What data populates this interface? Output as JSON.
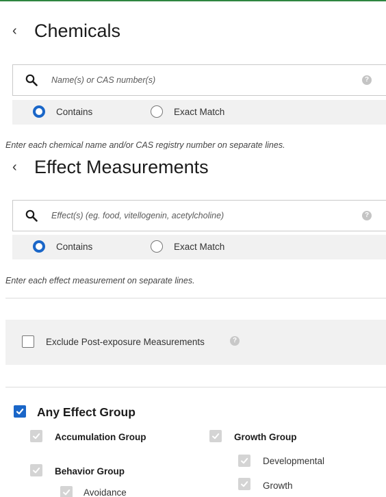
{
  "colors": {
    "accent": "#1a66c8",
    "top_border": "#2e8540",
    "panel": "#f1f1f1"
  },
  "chemicals": {
    "back_icon": "chevron-left-icon",
    "title": "Chemicals",
    "search_placeholder": "Name(s) or CAS number(s)",
    "options": [
      {
        "label": "Contains",
        "selected": true
      },
      {
        "label": "Exact Match",
        "selected": false
      }
    ],
    "hint": "Enter each chemical name and/or CAS registry number on separate lines."
  },
  "effects": {
    "back_icon": "chevron-left-icon",
    "title": "Effect Measurements",
    "search_placeholder": "Effect(s) (eg. food, vitellogenin, acetylcholine)",
    "options": [
      {
        "label": "Contains",
        "selected": true
      },
      {
        "label": "Exact Match",
        "selected": false
      }
    ],
    "hint": "Enter each effect measurement on separate lines."
  },
  "exclude_post_exposure": {
    "label": "Exclude Post-exposure Measurements",
    "checked": false
  },
  "effect_groups": {
    "any_label": "Any Effect Group",
    "any_checked": true,
    "groups": {
      "accumulation": "Accumulation Group",
      "behavior": "Behavior Group",
      "avoidance": "Avoidance",
      "growth": "Growth Group",
      "developmental": "Developmental",
      "growth_sub": "Growth"
    }
  }
}
